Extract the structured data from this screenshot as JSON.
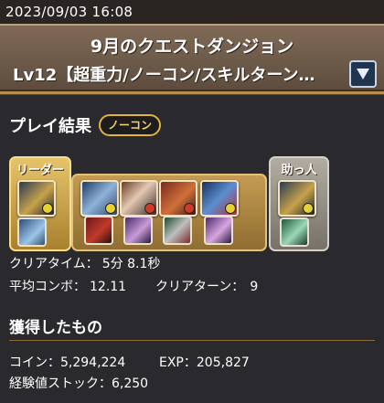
{
  "timestamp": "2023/09/03 16:08",
  "header": {
    "dungeon_title": "9月のクエストダンジョン",
    "floor_name": "Lv12【超重力/ノーコン/スキルターン…"
  },
  "result": {
    "title": "プレイ結果",
    "badge": "ノーコン"
  },
  "team": {
    "leader_label": "リーダー",
    "helper_label": "助っ人"
  },
  "stats": {
    "clear_time_label": "クリアタイム：",
    "clear_time": "5分 8.1秒",
    "avg_combo_label": "平均コンボ：",
    "avg_combo": "12.11",
    "clear_turn_label": "クリアターン：",
    "clear_turn": "9"
  },
  "rewards": {
    "title": "獲得したもの",
    "coin_label": "コイン：",
    "coin": "5,294,224",
    "exp_label": "EXP：",
    "exp": "205,827",
    "stock_label": "経験値ストック：",
    "stock": "6,250"
  },
  "colors": {
    "accent_gold": "#e0b43b",
    "header_brown": "#6d5a49",
    "panel_bg": "#2a292d"
  }
}
